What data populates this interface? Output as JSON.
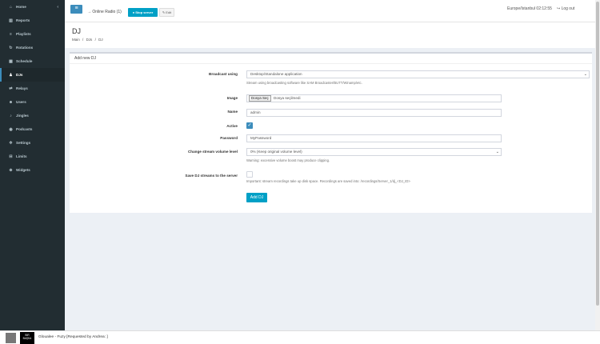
{
  "sidebar": {
    "items": [
      {
        "label": "Home",
        "icon": "home-icon",
        "glyph": "⌂",
        "chevron": "‹"
      },
      {
        "label": "Reports",
        "icon": "chart-icon",
        "glyph": "▥"
      },
      {
        "label": "Playlists",
        "icon": "list-icon",
        "glyph": "≡"
      },
      {
        "label": "Rotations",
        "icon": "refresh-icon",
        "glyph": "↻"
      },
      {
        "label": "Schedule",
        "icon": "calendar-icon",
        "glyph": "▦"
      },
      {
        "label": "DJs",
        "icon": "user-icon",
        "glyph": "♟",
        "active": true
      },
      {
        "label": "Relays",
        "icon": "relay-icon",
        "glyph": "⇄"
      },
      {
        "label": "Users",
        "icon": "users-icon",
        "glyph": "☻"
      },
      {
        "label": "Jingles",
        "icon": "bell-icon",
        "glyph": "♪"
      },
      {
        "label": "Podcasts",
        "icon": "podcast-icon",
        "glyph": "◉"
      },
      {
        "label": "Settings",
        "icon": "gear-icon",
        "glyph": "✲"
      },
      {
        "label": "Limits",
        "icon": "limits-icon",
        "glyph": "⊟"
      },
      {
        "label": "Widgets",
        "icon": "widget-icon",
        "glyph": "⊕"
      }
    ]
  },
  "topbar": {
    "menu_glyph": "≡",
    "radio_label": "→  Online Radio (1)",
    "stop_label": "● Stop server",
    "edit_label": "✎ Edit",
    "timezone": "Europe/Istanbul 02:12:55",
    "logout_label": "↪  Log out"
  },
  "header": {
    "title": "DJ",
    "breadcrumb": [
      "Main",
      "/",
      "DJs",
      "/",
      "DJ"
    ]
  },
  "form": {
    "box_title": "Add new DJ",
    "broadcast": {
      "label": "Broadcast using",
      "value": "Desktop/Standalone application",
      "help": "Stream using broadcasting software like SAM Broadcaster/BUTT/Winamp/etc."
    },
    "image": {
      "label": "Image",
      "button": "Dosya Seç",
      "status": "Dosya seçilmedi"
    },
    "name": {
      "label": "Name",
      "value": "admin"
    },
    "active": {
      "label": "Active",
      "checked": true
    },
    "password": {
      "label": "Password",
      "value": "MyPassword"
    },
    "volume": {
      "label": "Change stream volume level",
      "value": "0% (Keep original volume level)",
      "help": "Warning: excessive volume boost may produce clipping."
    },
    "save_streams": {
      "label": "Save DJ streams to the server",
      "checked": false,
      "help": "Important: stream recordings take up disk space. Recordings are saved into: /recordings/Server_1/dj_<DJ_ID>"
    },
    "submit_label": "Add DJ"
  },
  "player": {
    "thumb_text": "BIR\nBAŞKA",
    "now_playing": "Gloualee - Fuzy [Requested by Andrea: ]"
  },
  "colors": {
    "sidebar_bg": "#222d32",
    "accent": "#3c8dbc",
    "button": "#00a0c6",
    "page_bg": "#ecf0f5"
  }
}
